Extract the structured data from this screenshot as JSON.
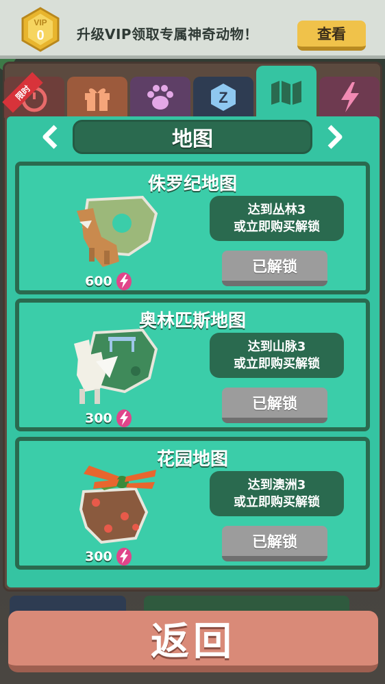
{
  "vip": {
    "badge_label": "VIP",
    "level": "0",
    "promo_text": "升级VIP领取专属神奇动物！",
    "view_button": "查看"
  },
  "tabs": [
    {
      "name": "limited",
      "icon": "stopwatch-icon",
      "ribbon": "限时",
      "color": "#6e3e3a"
    },
    {
      "name": "gift",
      "icon": "gift-icon",
      "color": "#9c5a3c"
    },
    {
      "name": "paw",
      "icon": "paw-icon",
      "color": "#5e3f66"
    },
    {
      "name": "currency",
      "icon": "coin-icon",
      "color": "#2e3c52"
    },
    {
      "name": "map",
      "icon": "map-icon",
      "color": "#35c4a2",
      "active": true
    },
    {
      "name": "energy",
      "icon": "lightning-icon",
      "color": "#6e3a50"
    }
  ],
  "header": {
    "title": "地图",
    "prev_icon": "chevron-left-icon",
    "next_icon": "chevron-right-icon"
  },
  "maps": [
    {
      "title": "侏罗纪地图",
      "requirement_line1": "达到丛林3",
      "requirement_line2": "或立即购买解锁",
      "button": "已解锁",
      "price": "600",
      "art": "dinosaur-island"
    },
    {
      "title": "奥林匹斯地图",
      "requirement_line1": "达到山脉3",
      "requirement_line2": "或立即购买解锁",
      "button": "已解锁",
      "price": "300",
      "art": "pegasus-island"
    },
    {
      "title": "花园地图",
      "requirement_line1": "达到澳洲3",
      "requirement_line2": "或立即购买解锁",
      "button": "已解锁",
      "price": "300",
      "art": "dragonfly-island"
    }
  ],
  "footer": {
    "return_button": "返回"
  },
  "colors": {
    "teal": "#35c4a2",
    "dark_green": "#2a6a4f",
    "vip_gold": "#f0c24a",
    "return_red": "#d98a78",
    "energy_pink": "#e0458a"
  }
}
